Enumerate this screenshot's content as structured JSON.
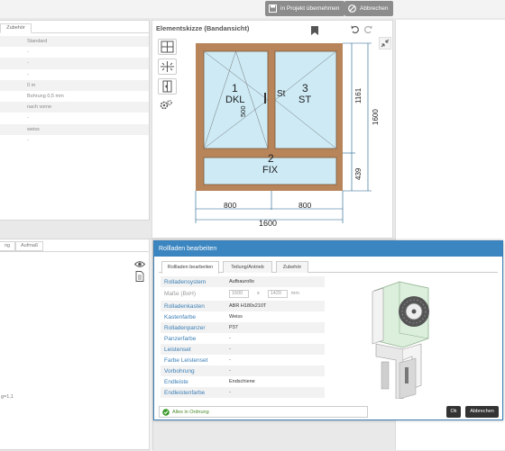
{
  "toolbar": {
    "apply_label": "in Projekt übernehmen",
    "cancel_label": "Abbrechen"
  },
  "left_panel": {
    "tab": "Zubehör",
    "rows": [
      "Standard",
      "-",
      "-",
      "-",
      "0 m",
      "Bohrung 0,5 mm",
      "nach vorne",
      "-",
      "weiss",
      "-"
    ]
  },
  "sketch": {
    "title": "Elementskizze (Bandansicht)",
    "sash_left": {
      "number": "1",
      "type": "DKL"
    },
    "sash_right": {
      "number": "3",
      "type": "ST"
    },
    "mullion_label": "St",
    "fixed": {
      "number": "2",
      "type": "FIX"
    },
    "handle_height": "500",
    "dims": {
      "upper_height": "1161",
      "lower_height": "439",
      "total_height": "1600",
      "left_width": "800",
      "right_width": "800",
      "total_width": "1600"
    }
  },
  "lower_left": {
    "tabs": [
      "ng",
      "Aufmaß"
    ],
    "code_text": "g=1,1"
  },
  "dialog": {
    "title": "Rollladen bearbeiten",
    "tabs": [
      "Rollladen bearbeiten",
      "Teilung/Antrieb",
      "Zubehör"
    ],
    "fields": [
      {
        "label": "Rolladensystem",
        "value": "Aufbaurollo"
      },
      {
        "label": "Maße (BxH)",
        "width": "1600",
        "height": "1420",
        "unit": "mm"
      },
      {
        "label": "Rolladenkasten",
        "value": "ABR H180x210T"
      },
      {
        "label": "Kastenfarbe",
        "value": "Weiss"
      },
      {
        "label": "Rolladenpanzer",
        "value": "P37"
      },
      {
        "label": "Panzerfarbe",
        "value": "-"
      },
      {
        "label": "Leistenset",
        "value": "-"
      },
      {
        "label": "Farbe Leistenset",
        "value": "-"
      },
      {
        "label": "Vorbohrung",
        "value": "-"
      },
      {
        "label": "Endleiste",
        "value": "Endschiene"
      },
      {
        "label": "Endleistenfarbe",
        "value": "-"
      }
    ],
    "dim_x": "x",
    "status": "Alles in Ordnung",
    "ok_label": "Ok",
    "cancel_label": "Abbrechen"
  },
  "colors": {
    "frame": "#b8845a",
    "glass": "#cdeaf5",
    "accent": "#3b86c0",
    "dim_line": "#1a5f8a"
  }
}
